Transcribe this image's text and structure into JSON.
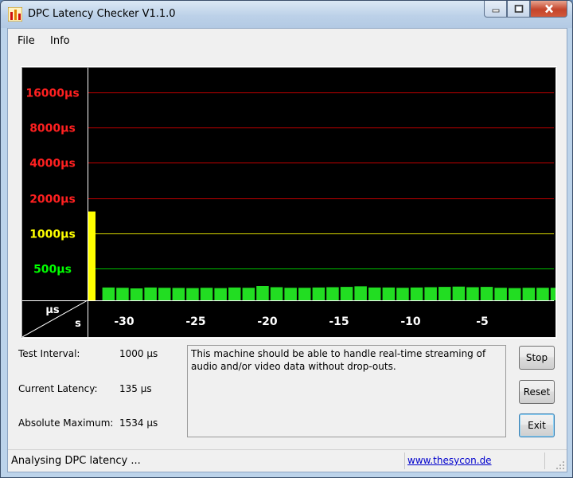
{
  "window": {
    "title": "DPC Latency Checker V1.1.0"
  },
  "menu": {
    "file": "File",
    "info": "Info"
  },
  "graph": {
    "y_labels": [
      {
        "text": "16000µs",
        "color": "#ff2020",
        "line_color": "#c00000"
      },
      {
        "text": "8000µs",
        "color": "#ff2020",
        "line_color": "#c00000"
      },
      {
        "text": "4000µs",
        "color": "#ff2020",
        "line_color": "#c00000"
      },
      {
        "text": "2000µs",
        "color": "#ff2020",
        "line_color": "#c00000"
      },
      {
        "text": "1000µs",
        "color": "#ffff00",
        "line_color": "#d8d800"
      },
      {
        "text": "500µs",
        "color": "#00ff00",
        "line_color": "#00c000"
      }
    ],
    "y_unit": "µs",
    "x_unit": "s",
    "x_ticks": [
      "-30",
      "-25",
      "-20",
      "-15",
      "-10",
      "-5"
    ]
  },
  "chart_data": {
    "type": "bar",
    "ylabel": "µs",
    "xlabel": "s",
    "y_scale": "log",
    "y_ticks": [
      500,
      1000,
      2000,
      4000,
      8000,
      16000
    ],
    "x_ticks": [
      -30,
      -25,
      -20,
      -15,
      -10,
      -5
    ],
    "values": [
      1534,
      135,
      130,
      120,
      135,
      130,
      128,
      125,
      130,
      125,
      135,
      130,
      160,
      140,
      130,
      130,
      135,
      140,
      145,
      155,
      135,
      135,
      130,
      135,
      140,
      145,
      150,
      140,
      145,
      130,
      125,
      130,
      130,
      130,
      145,
      130,
      130
    ],
    "bar_colors": {
      "over_1000": "#ffff00",
      "normal": "#22dd22"
    }
  },
  "info": {
    "test_interval_label": "Test Interval:",
    "test_interval_value": "1000 µs",
    "current_latency_label": "Current Latency:",
    "current_latency_value": "135 µs",
    "absolute_max_label": "Absolute Maximum:",
    "absolute_max_value": "1534 µs"
  },
  "message": "This machine should be able to handle real-time streaming of audio and/or video data without drop-outs.",
  "buttons": {
    "stop": "Stop",
    "reset": "Reset",
    "exit": "Exit"
  },
  "status": {
    "text": "Analysing DPC latency ...",
    "link": "www.thesycon.de"
  }
}
